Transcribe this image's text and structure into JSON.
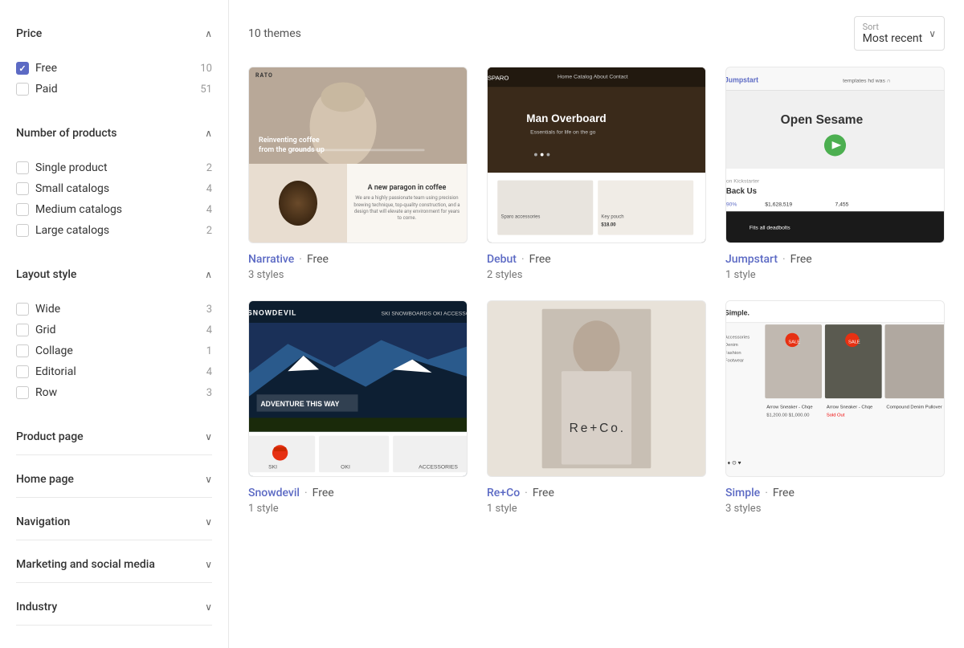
{
  "sidebar": {
    "sections": [
      {
        "id": "price",
        "title": "Price",
        "open": true,
        "items": [
          {
            "label": "Free",
            "count": 10,
            "checked": true
          },
          {
            "label": "Paid",
            "count": 51,
            "checked": false
          }
        ]
      },
      {
        "id": "number-of-products",
        "title": "Number of products",
        "open": true,
        "items": [
          {
            "label": "Single product",
            "count": 2,
            "checked": false
          },
          {
            "label": "Small catalogs",
            "count": 4,
            "checked": false
          },
          {
            "label": "Medium catalogs",
            "count": 4,
            "checked": false
          },
          {
            "label": "Large catalogs",
            "count": 2,
            "checked": false
          }
        ]
      },
      {
        "id": "layout-style",
        "title": "Layout style",
        "open": true,
        "items": [
          {
            "label": "Wide",
            "count": 3,
            "checked": false
          },
          {
            "label": "Grid",
            "count": 4,
            "checked": false
          },
          {
            "label": "Collage",
            "count": 1,
            "checked": false
          },
          {
            "label": "Editorial",
            "count": 4,
            "checked": false
          },
          {
            "label": "Row",
            "count": 3,
            "checked": false
          }
        ]
      },
      {
        "id": "product-page",
        "title": "Product page",
        "open": false,
        "items": []
      },
      {
        "id": "home-page",
        "title": "Home page",
        "open": false,
        "items": []
      },
      {
        "id": "navigation",
        "title": "Navigation",
        "open": false,
        "items": []
      },
      {
        "id": "marketing-social",
        "title": "Marketing and social media",
        "open": false,
        "items": []
      },
      {
        "id": "industry",
        "title": "Industry",
        "open": false,
        "items": []
      }
    ]
  },
  "main": {
    "themes_count": "10 themes",
    "sort": {
      "label": "Sort",
      "value": "Most recent"
    },
    "themes": [
      {
        "id": "narrative",
        "name": "Narrative",
        "price": "Free",
        "styles": "3 styles",
        "mockup": "narrative"
      },
      {
        "id": "debut",
        "name": "Debut",
        "price": "Free",
        "styles": "2 styles",
        "mockup": "debut"
      },
      {
        "id": "jumpstart",
        "name": "Jumpstart",
        "price": "Free",
        "styles": "1 style",
        "mockup": "jumpstart"
      },
      {
        "id": "snowdevil",
        "name": "Snowdevil",
        "price": "Free",
        "styles": "1 style",
        "mockup": "snowdevil"
      },
      {
        "id": "reco",
        "name": "Re+Co",
        "price": "Free",
        "styles": "1 style",
        "mockup": "reco"
      },
      {
        "id": "simple",
        "name": "Simple",
        "price": "Free",
        "styles": "3 styles",
        "mockup": "simple"
      }
    ]
  }
}
